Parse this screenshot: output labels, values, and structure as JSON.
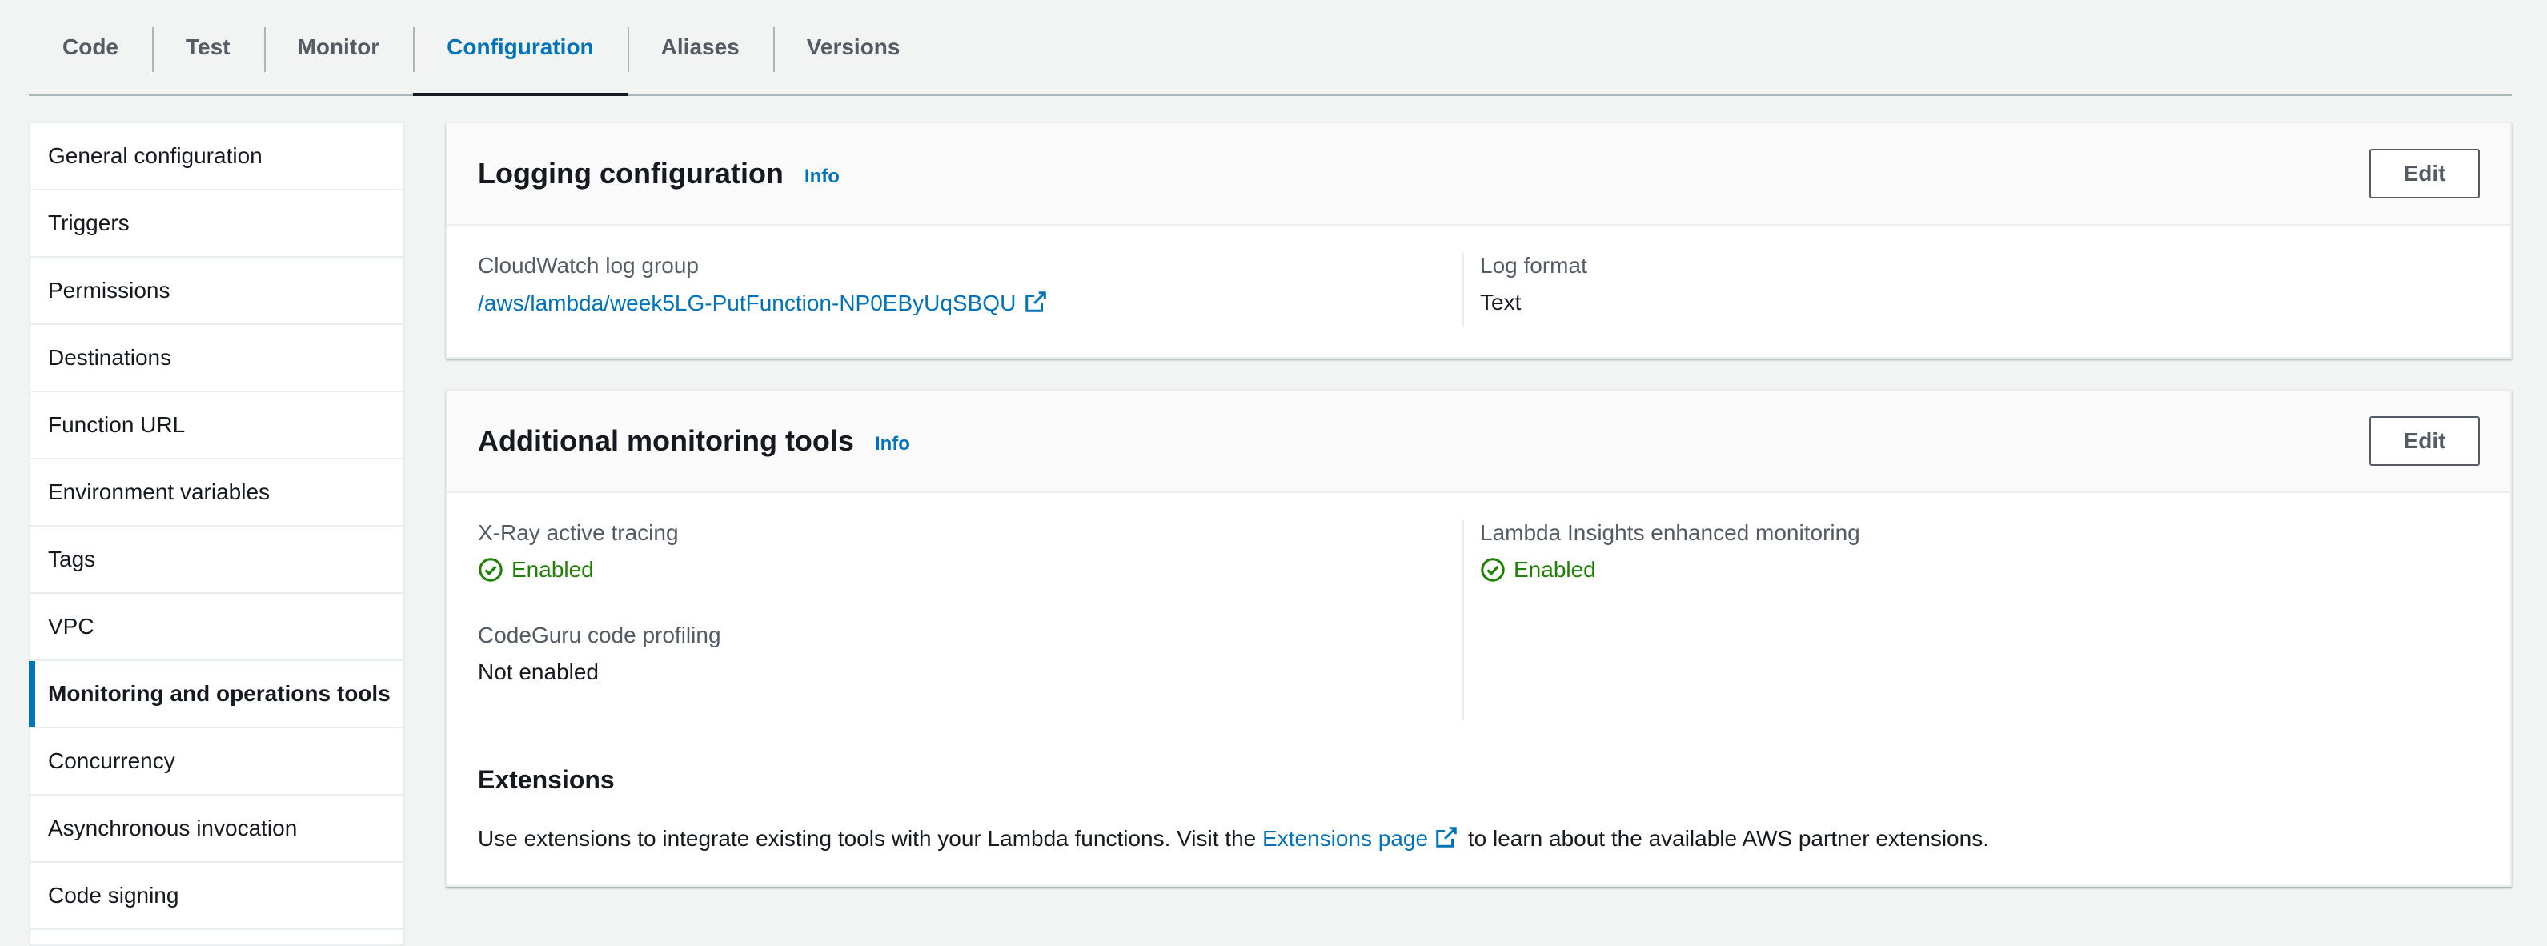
{
  "tabs": [
    {
      "label": "Code"
    },
    {
      "label": "Test"
    },
    {
      "label": "Monitor"
    },
    {
      "label": "Configuration",
      "active": true
    },
    {
      "label": "Aliases"
    },
    {
      "label": "Versions"
    }
  ],
  "sidebar": {
    "items": [
      {
        "label": "General configuration"
      },
      {
        "label": "Triggers"
      },
      {
        "label": "Permissions"
      },
      {
        "label": "Destinations"
      },
      {
        "label": "Function URL"
      },
      {
        "label": "Environment variables"
      },
      {
        "label": "Tags"
      },
      {
        "label": "VPC"
      },
      {
        "label": "Monitoring and operations tools",
        "active": true
      },
      {
        "label": "Concurrency"
      },
      {
        "label": "Asynchronous invocation"
      },
      {
        "label": "Code signing"
      }
    ]
  },
  "logging": {
    "title": "Logging configuration",
    "info": "Info",
    "edit": "Edit",
    "log_group_label": "CloudWatch log group",
    "log_group_value": "/aws/lambda/week5LG-PutFunction-NP0EByUqSBQU",
    "log_format_label": "Log format",
    "log_format_value": "Text"
  },
  "monitoring": {
    "title": "Additional monitoring tools",
    "info": "Info",
    "edit": "Edit",
    "xray_label": "X-Ray active tracing",
    "xray_value": "Enabled",
    "insights_label": "Lambda Insights enhanced monitoring",
    "insights_value": "Enabled",
    "codeguru_label": "CodeGuru code profiling",
    "codeguru_value": "Not enabled",
    "extensions_title": "Extensions",
    "extensions_text_before": "Use extensions to integrate existing tools with your Lambda functions. Visit the",
    "extensions_link": "Extensions page",
    "extensions_text_after": "to learn about the available AWS partner extensions."
  },
  "colors": {
    "accent": "#0073bb",
    "success": "#1d8102",
    "text": "#16191f",
    "muted": "#545b64",
    "background": "#f2f3f3"
  }
}
